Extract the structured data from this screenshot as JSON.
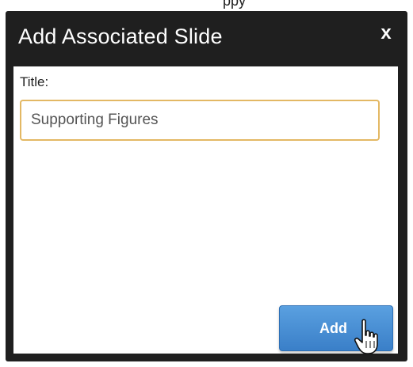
{
  "window": {
    "top_cutoff_text": "ppy",
    "title": "Add Associated Slide",
    "close_label": "x"
  },
  "form": {
    "title_label": "Title:",
    "title_value": "Supporting Figures"
  },
  "actions": {
    "add_label": "Add"
  },
  "icons": {
    "pointer": "hand-pointer-icon"
  },
  "colors": {
    "dialog_bg": "#1f1f1f",
    "input_focus_border": "#e3b864",
    "button_blue": "#3a7fc8"
  }
}
